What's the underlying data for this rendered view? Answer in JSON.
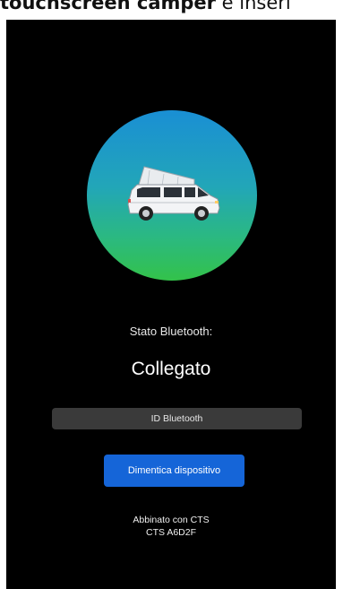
{
  "heading": {
    "bold": "touchscreen camper",
    "rest": " e inseri"
  },
  "screen": {
    "bluetooth_label": "Stato Bluetooth:",
    "bluetooth_status": "Collegato",
    "id_button_label": "ID Bluetooth",
    "forget_button_label": "Dimentica dispositivo",
    "paired_line1": "Abbinato con CTS",
    "paired_line2": "CTS A6D2F"
  },
  "colors": {
    "screen_bg": "#000000",
    "accent_button": "#1565d8",
    "id_button_bg": "#3a3a3a",
    "gradient_top": "#1a8fd4",
    "gradient_bottom": "#33c24a"
  },
  "icons": {
    "avatar": "camper-van-icon"
  }
}
